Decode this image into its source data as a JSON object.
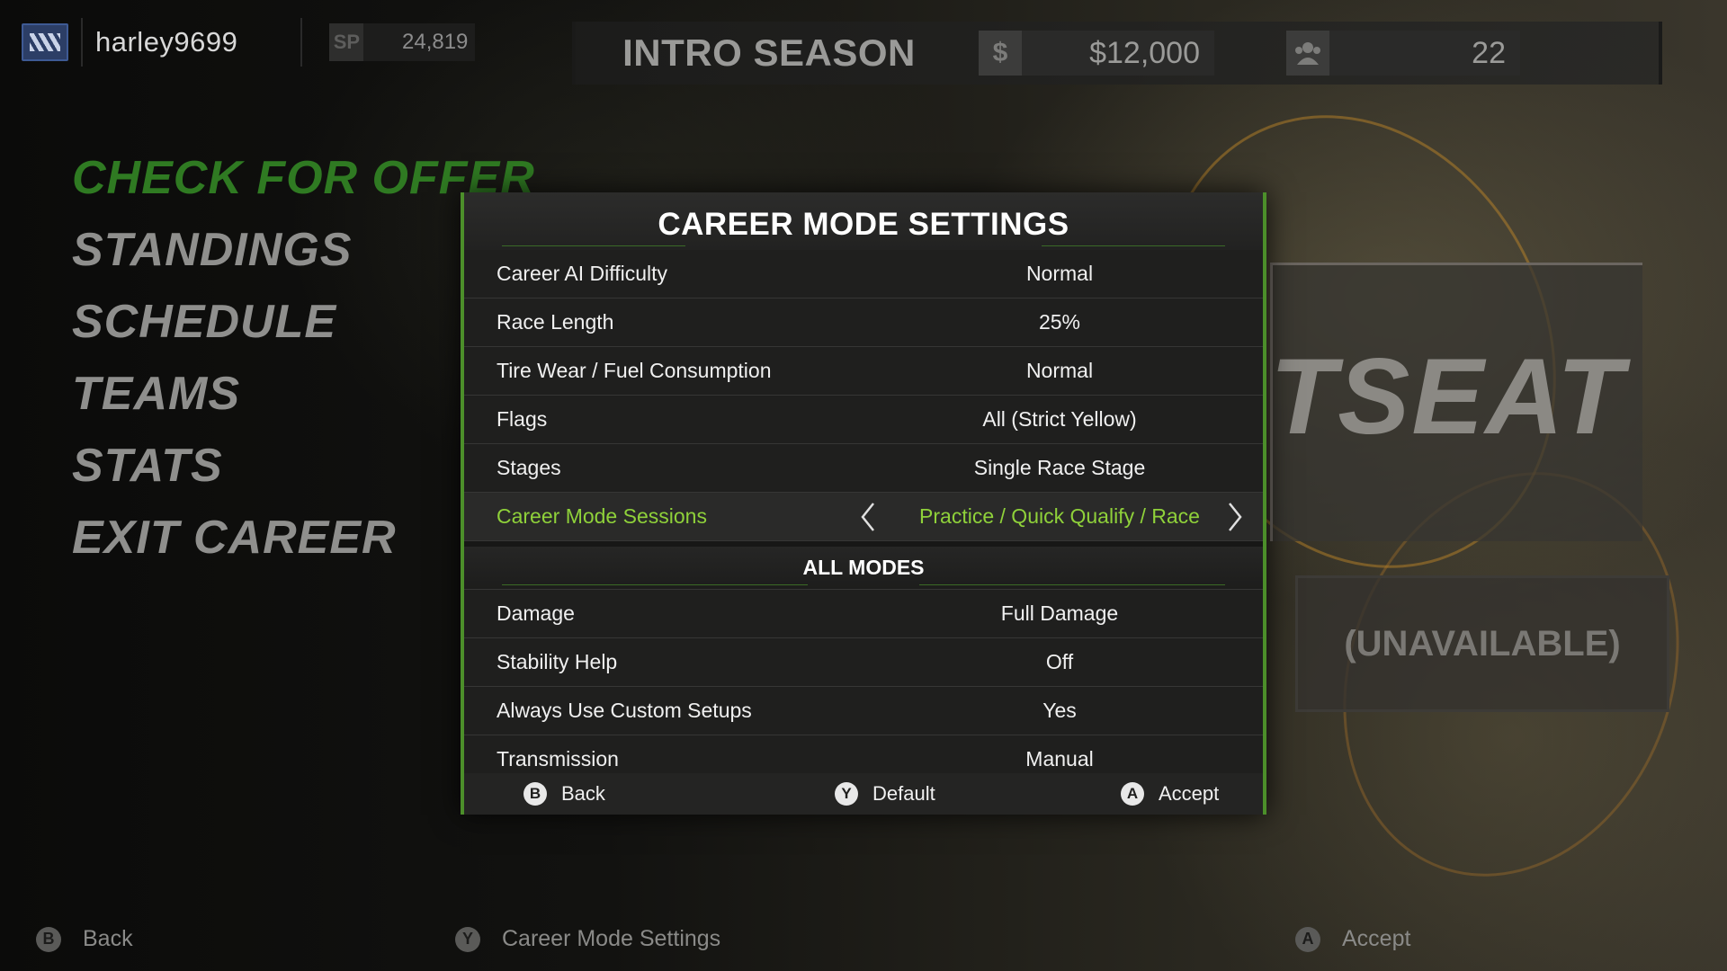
{
  "header": {
    "username": "harley9699",
    "sp_label": "SP",
    "sp_value": "24,819",
    "season_title": "INTRO SEASON",
    "money_icon": "$",
    "money_value": "$12,000",
    "fans_value": "22"
  },
  "left_menu": {
    "items": [
      {
        "label": "CHECK FOR OFFER",
        "active": true
      },
      {
        "label": "STANDINGS"
      },
      {
        "label": "SCHEDULE"
      },
      {
        "label": "TEAMS"
      },
      {
        "label": "STATS"
      },
      {
        "label": "EXIT CAREER"
      }
    ]
  },
  "background_cards": {
    "seat_text": "TSEAT",
    "unavailable_text": "(UNAVAILABLE)"
  },
  "dialog": {
    "title": "CAREER MODE SETTINGS",
    "settings": [
      {
        "label": "Career AI Difficulty",
        "value": "Normal"
      },
      {
        "label": "Race Length",
        "value": "25%"
      },
      {
        "label": "Tire Wear / Fuel Consumption",
        "value": "Normal"
      },
      {
        "label": "Flags",
        "value": "All (Strict Yellow)"
      },
      {
        "label": "Stages",
        "value": "Single Race Stage"
      },
      {
        "label": "Career Mode Sessions",
        "value": "Practice / Quick Qualify / Race",
        "selected": true
      }
    ],
    "section_title": "ALL MODES",
    "all_modes": [
      {
        "label": "Damage",
        "value": "Full Damage"
      },
      {
        "label": "Stability Help",
        "value": "Off"
      },
      {
        "label": "Always Use Custom Setups",
        "value": "Yes"
      },
      {
        "label": "Transmission",
        "value": "Manual"
      }
    ],
    "footer": {
      "back_key": "B",
      "back_label": "Back",
      "default_key": "Y",
      "default_label": "Default",
      "accept_key": "A",
      "accept_label": "Accept"
    }
  },
  "bottom_bar": {
    "back_key": "B",
    "back_label": "Back",
    "settings_key": "Y",
    "settings_label": "Career Mode Settings",
    "accept_key": "A",
    "accept_label": "Accept"
  },
  "colors": {
    "accent_green": "#8fd13a",
    "active_menu_green": "#2f7a22",
    "dialog_border": "#4c8f2a"
  }
}
